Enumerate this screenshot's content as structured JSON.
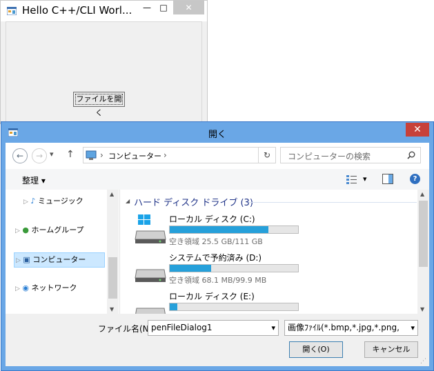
{
  "parent_window": {
    "title": "Hello C++/CLI Worl...",
    "minimize_glyph": "—",
    "maximize_glyph": "□",
    "close_glyph": "✕",
    "open_button_label": "ファイルを開く"
  },
  "dialog": {
    "title": "開く",
    "close_glyph": "✕",
    "address": {
      "back_glyph": "←",
      "forward_glyph": "→",
      "recent_glyph": "▾",
      "up_glyph": "↑",
      "separator_glyph": "›",
      "path_segment": "コンピューター",
      "refresh_glyph": "↻"
    },
    "search_placeholder": "コンピューターの検索",
    "toolbar": {
      "organize_label": "整理 ▾",
      "view_glyph": "▾",
      "help_glyph": "?"
    },
    "nav": {
      "items": [
        {
          "label": "ミュージック"
        },
        {
          "label": "ホームグループ"
        },
        {
          "label": "コンピューター"
        },
        {
          "label": "ネットワーク"
        }
      ],
      "expander_glyph": "▷",
      "scroll_up_glyph": "▲",
      "scroll_down_glyph": "▼"
    },
    "content": {
      "group_header": "ハード ディスク ドライブ (3)",
      "collapse_glyph": "◢",
      "drives": [
        {
          "name": "ローカル ディスク (C:)",
          "free_text": "空き領域 25.5 GB/111 GB",
          "used_fraction": 0.77
        },
        {
          "name": "システムで予約済み (D:)",
          "free_text": "空き領域 68.1 MB/99.9 MB",
          "used_fraction": 0.32
        },
        {
          "name": "ローカル ディスク (E:)",
          "free_text": "",
          "used_fraction": 0.06
        }
      ]
    },
    "filename_label": "ファイル名(N):",
    "filename_value": "penFileDialog1",
    "filter_value": "画像ﾌｧｲﾙ(*.bmp,*.jpg,*.png,",
    "combo_arrow": "▾",
    "open_label": "開く(O)",
    "cancel_label": "キャンセル"
  },
  "colors": {
    "accent": "#26a0da",
    "dialog_frame": "#6aa7e6",
    "close_red": "#c7413a",
    "selection": "#cce8ff"
  }
}
